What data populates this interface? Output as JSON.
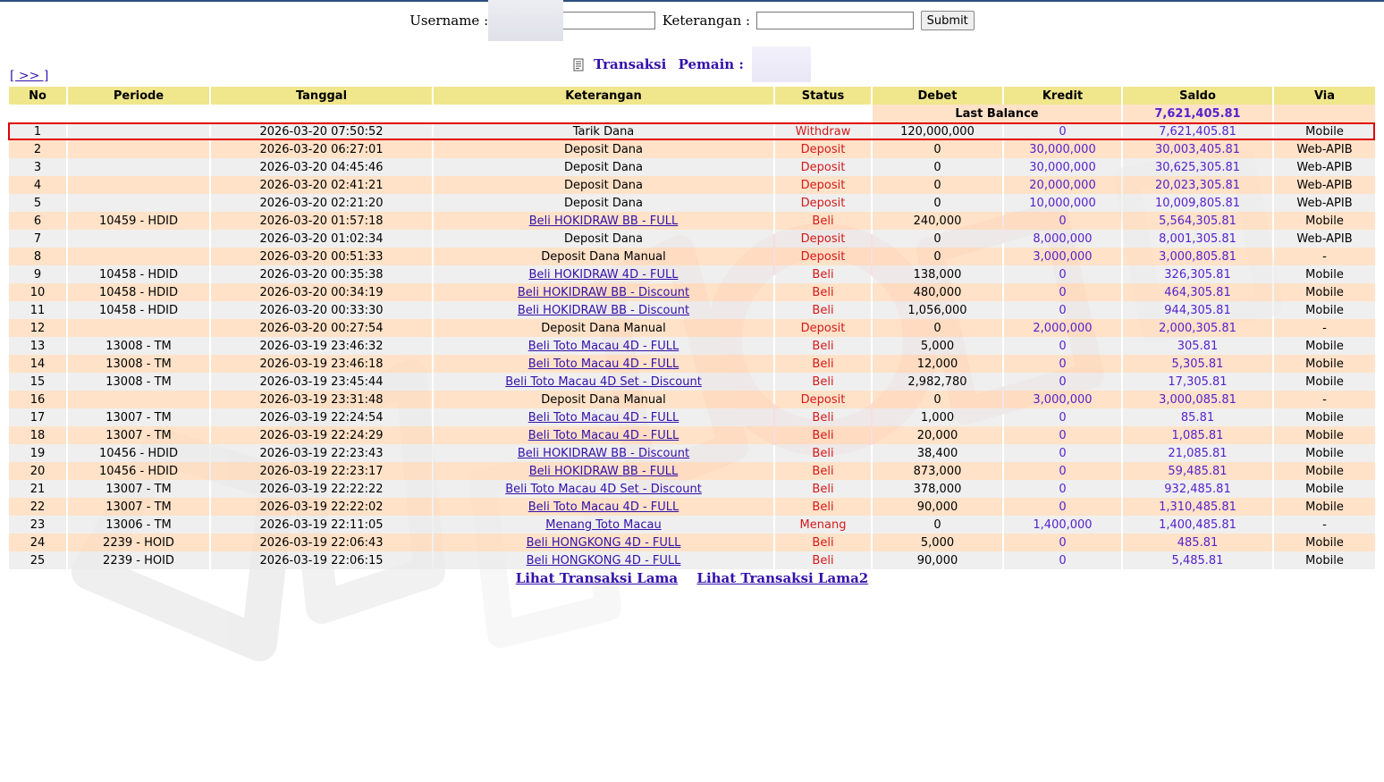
{
  "search": {
    "username_label": "Username :",
    "keterangan_label": "Keterangan :",
    "submit_label": "Submit"
  },
  "title": {
    "transaksi": "Transaksi",
    "pemain": "Pemain :"
  },
  "nav": {
    "next": "[ >> ]"
  },
  "table": {
    "headers": [
      "No",
      "Periode",
      "Tanggal",
      "Keterangan",
      "Status",
      "Debet",
      "Kredit",
      "Saldo",
      "Via"
    ],
    "last_balance_label": "Last Balance",
    "last_balance_value": "7,621,405.81",
    "rows": [
      {
        "no": "1",
        "periode": "",
        "tanggal": "2026-03-20 07:50:52",
        "ket": "Tarik Dana",
        "link": false,
        "status": "Withdraw",
        "debet": "120,000,000",
        "kredit": "0",
        "saldo": "7,621,405.81",
        "via": "Mobile"
      },
      {
        "no": "2",
        "periode": "",
        "tanggal": "2026-03-20 06:27:01",
        "ket": "Deposit Dana",
        "link": false,
        "status": "Deposit",
        "debet": "0",
        "kredit": "30,000,000",
        "saldo": "30,003,405.81",
        "via": "Web-APIB"
      },
      {
        "no": "3",
        "periode": "",
        "tanggal": "2026-03-20 04:45:46",
        "ket": "Deposit Dana",
        "link": false,
        "status": "Deposit",
        "debet": "0",
        "kredit": "30,000,000",
        "saldo": "30,625,305.81",
        "via": "Web-APIB"
      },
      {
        "no": "4",
        "periode": "",
        "tanggal": "2026-03-20 02:41:21",
        "ket": "Deposit Dana",
        "link": false,
        "status": "Deposit",
        "debet": "0",
        "kredit": "20,000,000",
        "saldo": "20,023,305.81",
        "via": "Web-APIB"
      },
      {
        "no": "5",
        "periode": "",
        "tanggal": "2026-03-20 02:21:20",
        "ket": "Deposit Dana",
        "link": false,
        "status": "Deposit",
        "debet": "0",
        "kredit": "10,000,000",
        "saldo": "10,009,805.81",
        "via": "Web-APIB"
      },
      {
        "no": "6",
        "periode": "10459 - HDID",
        "tanggal": "2026-03-20 01:57:18",
        "ket": "Beli HOKIDRAW BB - FULL",
        "link": true,
        "status": "Beli",
        "debet": "240,000",
        "kredit": "0",
        "saldo": "5,564,305.81",
        "via": "Mobile"
      },
      {
        "no": "7",
        "periode": "",
        "tanggal": "2026-03-20 01:02:34",
        "ket": "Deposit Dana",
        "link": false,
        "status": "Deposit",
        "debet": "0",
        "kredit": "8,000,000",
        "saldo": "8,001,305.81",
        "via": "Web-APIB"
      },
      {
        "no": "8",
        "periode": "",
        "tanggal": "2026-03-20 00:51:33",
        "ket": "Deposit Dana Manual",
        "link": false,
        "status": "Deposit",
        "debet": "0",
        "kredit": "3,000,000",
        "saldo": "3,000,805.81",
        "via": "-"
      },
      {
        "no": "9",
        "periode": "10458 - HDID",
        "tanggal": "2026-03-20 00:35:38",
        "ket": "Beli HOKIDRAW 4D - FULL",
        "link": true,
        "status": "Beli",
        "debet": "138,000",
        "kredit": "0",
        "saldo": "326,305.81",
        "via": "Mobile"
      },
      {
        "no": "10",
        "periode": "10458 - HDID",
        "tanggal": "2026-03-20 00:34:19",
        "ket": "Beli HOKIDRAW BB - Discount",
        "link": true,
        "status": "Beli",
        "debet": "480,000",
        "kredit": "0",
        "saldo": "464,305.81",
        "via": "Mobile"
      },
      {
        "no": "11",
        "periode": "10458 - HDID",
        "tanggal": "2026-03-20 00:33:30",
        "ket": "Beli HOKIDRAW BB - Discount",
        "link": true,
        "status": "Beli",
        "debet": "1,056,000",
        "kredit": "0",
        "saldo": "944,305.81",
        "via": "Mobile"
      },
      {
        "no": "12",
        "periode": "",
        "tanggal": "2026-03-20 00:27:54",
        "ket": "Deposit Dana Manual",
        "link": false,
        "status": "Deposit",
        "debet": "0",
        "kredit": "2,000,000",
        "saldo": "2,000,305.81",
        "via": "-"
      },
      {
        "no": "13",
        "periode": "13008 - TM",
        "tanggal": "2026-03-19 23:46:32",
        "ket": "Beli Toto Macau 4D - FULL",
        "link": true,
        "status": "Beli",
        "debet": "5,000",
        "kredit": "0",
        "saldo": "305.81",
        "via": "Mobile"
      },
      {
        "no": "14",
        "periode": "13008 - TM",
        "tanggal": "2026-03-19 23:46:18",
        "ket": "Beli Toto Macau 4D - FULL",
        "link": true,
        "status": "Beli",
        "debet": "12,000",
        "kredit": "0",
        "saldo": "5,305.81",
        "via": "Mobile"
      },
      {
        "no": "15",
        "periode": "13008 - TM",
        "tanggal": "2026-03-19 23:45:44",
        "ket": "Beli Toto Macau 4D Set - Discount",
        "link": true,
        "status": "Beli",
        "debet": "2,982,780",
        "kredit": "0",
        "saldo": "17,305.81",
        "via": "Mobile"
      },
      {
        "no": "16",
        "periode": "",
        "tanggal": "2026-03-19 23:31:48",
        "ket": "Deposit Dana Manual",
        "link": false,
        "status": "Deposit",
        "debet": "0",
        "kredit": "3,000,000",
        "saldo": "3,000,085.81",
        "via": "-"
      },
      {
        "no": "17",
        "periode": "13007 - TM",
        "tanggal": "2026-03-19 22:24:54",
        "ket": "Beli Toto Macau 4D - FULL",
        "link": true,
        "status": "Beli",
        "debet": "1,000",
        "kredit": "0",
        "saldo": "85.81",
        "via": "Mobile"
      },
      {
        "no": "18",
        "periode": "13007 - TM",
        "tanggal": "2026-03-19 22:24:29",
        "ket": "Beli Toto Macau 4D - FULL",
        "link": true,
        "status": "Beli",
        "debet": "20,000",
        "kredit": "0",
        "saldo": "1,085.81",
        "via": "Mobile"
      },
      {
        "no": "19",
        "periode": "10456 - HDID",
        "tanggal": "2026-03-19 22:23:43",
        "ket": "Beli HOKIDRAW BB - Discount",
        "link": true,
        "status": "Beli",
        "debet": "38,400",
        "kredit": "0",
        "saldo": "21,085.81",
        "via": "Mobile"
      },
      {
        "no": "20",
        "periode": "10456 - HDID",
        "tanggal": "2026-03-19 22:23:17",
        "ket": "Beli HOKIDRAW BB - FULL",
        "link": true,
        "status": "Beli",
        "debet": "873,000",
        "kredit": "0",
        "saldo": "59,485.81",
        "via": "Mobile"
      },
      {
        "no": "21",
        "periode": "13007 - TM",
        "tanggal": "2026-03-19 22:22:22",
        "ket": "Beli Toto Macau 4D Set - Discount",
        "link": true,
        "status": "Beli",
        "debet": "378,000",
        "kredit": "0",
        "saldo": "932,485.81",
        "via": "Mobile"
      },
      {
        "no": "22",
        "periode": "13007 - TM",
        "tanggal": "2026-03-19 22:22:02",
        "ket": "Beli Toto Macau 4D - FULL",
        "link": true,
        "status": "Beli",
        "debet": "90,000",
        "kredit": "0",
        "saldo": "1,310,485.81",
        "via": "Mobile"
      },
      {
        "no": "23",
        "periode": "13006 - TM",
        "tanggal": "2026-03-19 22:11:05",
        "ket": "Menang Toto Macau",
        "link": true,
        "status": "Menang",
        "debet": "0",
        "kredit": "1,400,000",
        "saldo": "1,400,485.81",
        "via": "-"
      },
      {
        "no": "24",
        "periode": "2239 - HOID",
        "tanggal": "2026-03-19 22:06:43",
        "ket": "Beli HONGKONG 4D - FULL",
        "link": true,
        "status": "Beli",
        "debet": "5,000",
        "kredit": "0",
        "saldo": "485.81",
        "via": "Mobile"
      },
      {
        "no": "25",
        "periode": "2239 - HOID",
        "tanggal": "2026-03-19 22:06:15",
        "ket": "Beli HONGKONG 4D - FULL",
        "link": true,
        "status": "Beli",
        "debet": "90,000",
        "kredit": "0",
        "saldo": "5,485.81",
        "via": "Mobile"
      }
    ]
  },
  "footer": {
    "link1": "Lihat Transaksi Lama",
    "link2": "Lihat Transaksi Lama2"
  },
  "colors": {
    "header_bg": "#f0e68c",
    "row_even": "#ffdab9",
    "row_odd": "#ebebeb",
    "status": "#d31a1a",
    "link": "#3311aa",
    "highlight": "#e00000"
  }
}
